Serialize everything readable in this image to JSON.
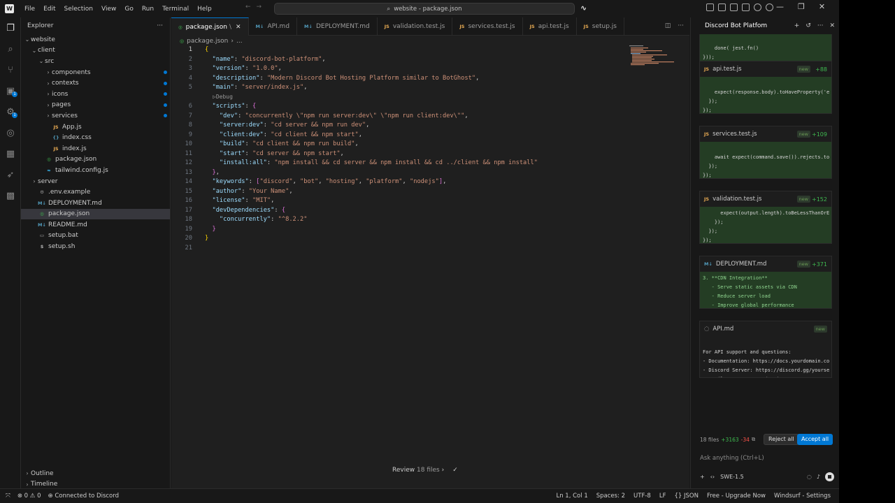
{
  "titlebar": {
    "menu": [
      "File",
      "Edit",
      "Selection",
      "View",
      "Go",
      "Run",
      "Terminal",
      "Help"
    ],
    "command_center": "website - package.json"
  },
  "explorer": {
    "title": "Explorer",
    "tree": [
      {
        "label": "website",
        "depth": 0,
        "type": "folder-open"
      },
      {
        "label": "client",
        "depth": 1,
        "type": "folder-open"
      },
      {
        "label": "src",
        "depth": 2,
        "type": "folder-open"
      },
      {
        "label": "components",
        "depth": 3,
        "type": "folder",
        "dot": "#0078d4"
      },
      {
        "label": "contexts",
        "depth": 3,
        "type": "folder",
        "dot": "#0078d4"
      },
      {
        "label": "icons",
        "depth": 3,
        "type": "folder",
        "dot": "#0078d4"
      },
      {
        "label": "pages",
        "depth": 3,
        "type": "folder",
        "dot": "#0078d4"
      },
      {
        "label": "services",
        "depth": 3,
        "type": "folder",
        "dot": "#0078d4"
      },
      {
        "label": "App.js",
        "depth": 3,
        "type": "js"
      },
      {
        "label": "index.css",
        "depth": 3,
        "type": "css"
      },
      {
        "label": "index.js",
        "depth": 3,
        "type": "js"
      },
      {
        "label": "package.json",
        "depth": 2,
        "type": "json"
      },
      {
        "label": "tailwind.config.js",
        "depth": 2,
        "type": "tw"
      },
      {
        "label": "server",
        "depth": 1,
        "type": "folder"
      },
      {
        "label": ".env.example",
        "depth": 1,
        "type": "env"
      },
      {
        "label": "DEPLOYMENT.md",
        "depth": 1,
        "type": "md"
      },
      {
        "label": "package.json",
        "depth": 1,
        "type": "json",
        "selected": true
      },
      {
        "label": "README.md",
        "depth": 1,
        "type": "md"
      },
      {
        "label": "setup.bat",
        "depth": 1,
        "type": "bat"
      },
      {
        "label": "setup.sh",
        "depth": 1,
        "type": "sh"
      }
    ],
    "outline_label": "Outline",
    "timeline_label": "Timeline"
  },
  "editor": {
    "tabs": [
      {
        "label": "package.json",
        "icon": "json",
        "active": true,
        "suffix": "\\"
      },
      {
        "label": "API.md",
        "icon": "md"
      },
      {
        "label": "DEPLOYMENT.md",
        "icon": "md"
      },
      {
        "label": "validation.test.js",
        "icon": "js"
      },
      {
        "label": "services.test.js",
        "icon": "js"
      },
      {
        "label": "api.test.js",
        "icon": "js"
      },
      {
        "label": "setup.js",
        "icon": "js"
      }
    ],
    "breadcrumb": [
      "package.json",
      "..."
    ],
    "codelens": "Debug",
    "lines": [
      [
        [
          "b1",
          "{"
        ]
      ],
      [
        [
          "p",
          "  "
        ],
        [
          "k",
          "\"name\""
        ],
        [
          "p",
          ": "
        ],
        [
          "s",
          "\"discord-bot-platform\""
        ],
        [
          "p",
          ","
        ]
      ],
      [
        [
          "p",
          "  "
        ],
        [
          "k",
          "\"version\""
        ],
        [
          "p",
          ": "
        ],
        [
          "s",
          "\"1.0.0\""
        ],
        [
          "p",
          ","
        ]
      ],
      [
        [
          "p",
          "  "
        ],
        [
          "k",
          "\"description\""
        ],
        [
          "p",
          ": "
        ],
        [
          "s",
          "\"Modern Discord Bot Hosting Platform similar to BotGhost\""
        ],
        [
          "p",
          ","
        ]
      ],
      [
        [
          "p",
          "  "
        ],
        [
          "k",
          "\"main\""
        ],
        [
          "p",
          ": "
        ],
        [
          "s",
          "\"server/index.js\""
        ],
        [
          "p",
          ","
        ]
      ],
      [
        [
          "p",
          "  "
        ],
        [
          "k",
          "\"scripts\""
        ],
        [
          "p",
          ": "
        ],
        [
          "b2",
          "{"
        ]
      ],
      [
        [
          "p",
          "    "
        ],
        [
          "k",
          "\"dev\""
        ],
        [
          "p",
          ": "
        ],
        [
          "s",
          "\"concurrently \\\"npm run server:dev\\\" \\\"npm run client:dev\\\"\""
        ],
        [
          "p",
          ","
        ]
      ],
      [
        [
          "p",
          "    "
        ],
        [
          "k",
          "\"server:dev\""
        ],
        [
          "p",
          ": "
        ],
        [
          "s",
          "\"cd server && npm run dev\""
        ],
        [
          "p",
          ","
        ]
      ],
      [
        [
          "p",
          "    "
        ],
        [
          "k",
          "\"client:dev\""
        ],
        [
          "p",
          ": "
        ],
        [
          "s",
          "\"cd client && npm start\""
        ],
        [
          "p",
          ","
        ]
      ],
      [
        [
          "p",
          "    "
        ],
        [
          "k",
          "\"build\""
        ],
        [
          "p",
          ": "
        ],
        [
          "s",
          "\"cd client && npm run build\""
        ],
        [
          "p",
          ","
        ]
      ],
      [
        [
          "p",
          "    "
        ],
        [
          "k",
          "\"start\""
        ],
        [
          "p",
          ": "
        ],
        [
          "s",
          "\"cd server && npm start\""
        ],
        [
          "p",
          ","
        ]
      ],
      [
        [
          "p",
          "    "
        ],
        [
          "k",
          "\"install:all\""
        ],
        [
          "p",
          ": "
        ],
        [
          "s",
          "\"npm install && cd server && npm install && cd ../client && npm install\""
        ]
      ],
      [
        [
          "p",
          "  "
        ],
        [
          "b2",
          "}"
        ],
        [
          "p",
          ","
        ]
      ],
      [
        [
          "p",
          "  "
        ],
        [
          "k",
          "\"keywords\""
        ],
        [
          "p",
          ": "
        ],
        [
          "b2",
          "["
        ],
        [
          "s",
          "\"discord\""
        ],
        [
          "p",
          ", "
        ],
        [
          "s",
          "\"bot\""
        ],
        [
          "p",
          ", "
        ],
        [
          "s",
          "\"hosting\""
        ],
        [
          "p",
          ", "
        ],
        [
          "s",
          "\"platform\""
        ],
        [
          "p",
          ", "
        ],
        [
          "s",
          "\"nodejs\""
        ],
        [
          "b2",
          "]"
        ],
        [
          "p",
          ","
        ]
      ],
      [
        [
          "p",
          "  "
        ],
        [
          "k",
          "\"author\""
        ],
        [
          "p",
          ": "
        ],
        [
          "s",
          "\"Your Name\""
        ],
        [
          "p",
          ","
        ]
      ],
      [
        [
          "p",
          "  "
        ],
        [
          "k",
          "\"license\""
        ],
        [
          "p",
          ": "
        ],
        [
          "s",
          "\"MIT\""
        ],
        [
          "p",
          ","
        ]
      ],
      [
        [
          "p",
          "  "
        ],
        [
          "k",
          "\"devDependencies\""
        ],
        [
          "p",
          ": "
        ],
        [
          "b2",
          "{"
        ]
      ],
      [
        [
          "p",
          "    "
        ],
        [
          "k",
          "\"concurrently\""
        ],
        [
          "p",
          ": "
        ],
        [
          "s",
          "\"^8.2.2\""
        ]
      ],
      [
        [
          "p",
          "  "
        ],
        [
          "b2",
          "}"
        ]
      ],
      [
        [
          "b1",
          "}"
        ]
      ],
      []
    ],
    "review_label": "Review",
    "review_count": "18 files"
  },
  "chat": {
    "title": "Discord Bot Platfom",
    "top_snippet": "    done( jest.fn()\n}));",
    "cards": [
      {
        "file": "api.test.js",
        "icon": "JS",
        "tag": "new",
        "added": "+88",
        "body": "\n    expect(response.body).toHaveProperty('e\n  });\n});"
      },
      {
        "file": "services.test.js",
        "icon": "JS",
        "tag": "new",
        "added": "+109",
        "body": "\n    await expect(command.save()).rejects.to\n  });\n});"
      },
      {
        "file": "validation.test.js",
        "icon": "JS",
        "tag": "new",
        "added": "+152",
        "body": "      expect(output.length).toBeLessThanOrE\n    });\n  });\n});"
      },
      {
        "file": "DEPLOYMENT.md",
        "icon": "M↓",
        "tag": "new",
        "added": "+371",
        "body": "3. **CDN Integration**\n   - Serve static assets via CDN\n   - Reduce server load\n   - Improve global performance"
      },
      {
        "file": "API.md",
        "icon": "loading",
        "tag": "new",
        "added": "",
        "body": "\nFor API support and questions:\n- Documentation: https://docs.yourdomain.co\n- Discord Server: https://discord.gg/yourse\n- Email: support@yourdomain.com"
      }
    ],
    "files_summary": "18 files",
    "lines_added": "+3163",
    "lines_removed": "-34",
    "reject_label": "Reject all",
    "accept_label": "Accept all",
    "ask_placeholder": "Ask anything (Ctrl+L)",
    "model": "SWE-1.5"
  },
  "status": {
    "errors": "0",
    "warnings": "0",
    "connection": "Connected to Discord",
    "position": "Ln 1, Col 1",
    "spaces": "Spaces: 2",
    "encoding": "UTF-8",
    "eol": "LF",
    "language": "JSON",
    "plan": "Free - Upgrade Now",
    "settings": "Windsurf - Settings"
  },
  "colors": {
    "accent": "#0078d4",
    "json_key": "#9cdcfe",
    "json_string": "#ce9178",
    "added": "#3fb950",
    "removed": "#f85149"
  }
}
